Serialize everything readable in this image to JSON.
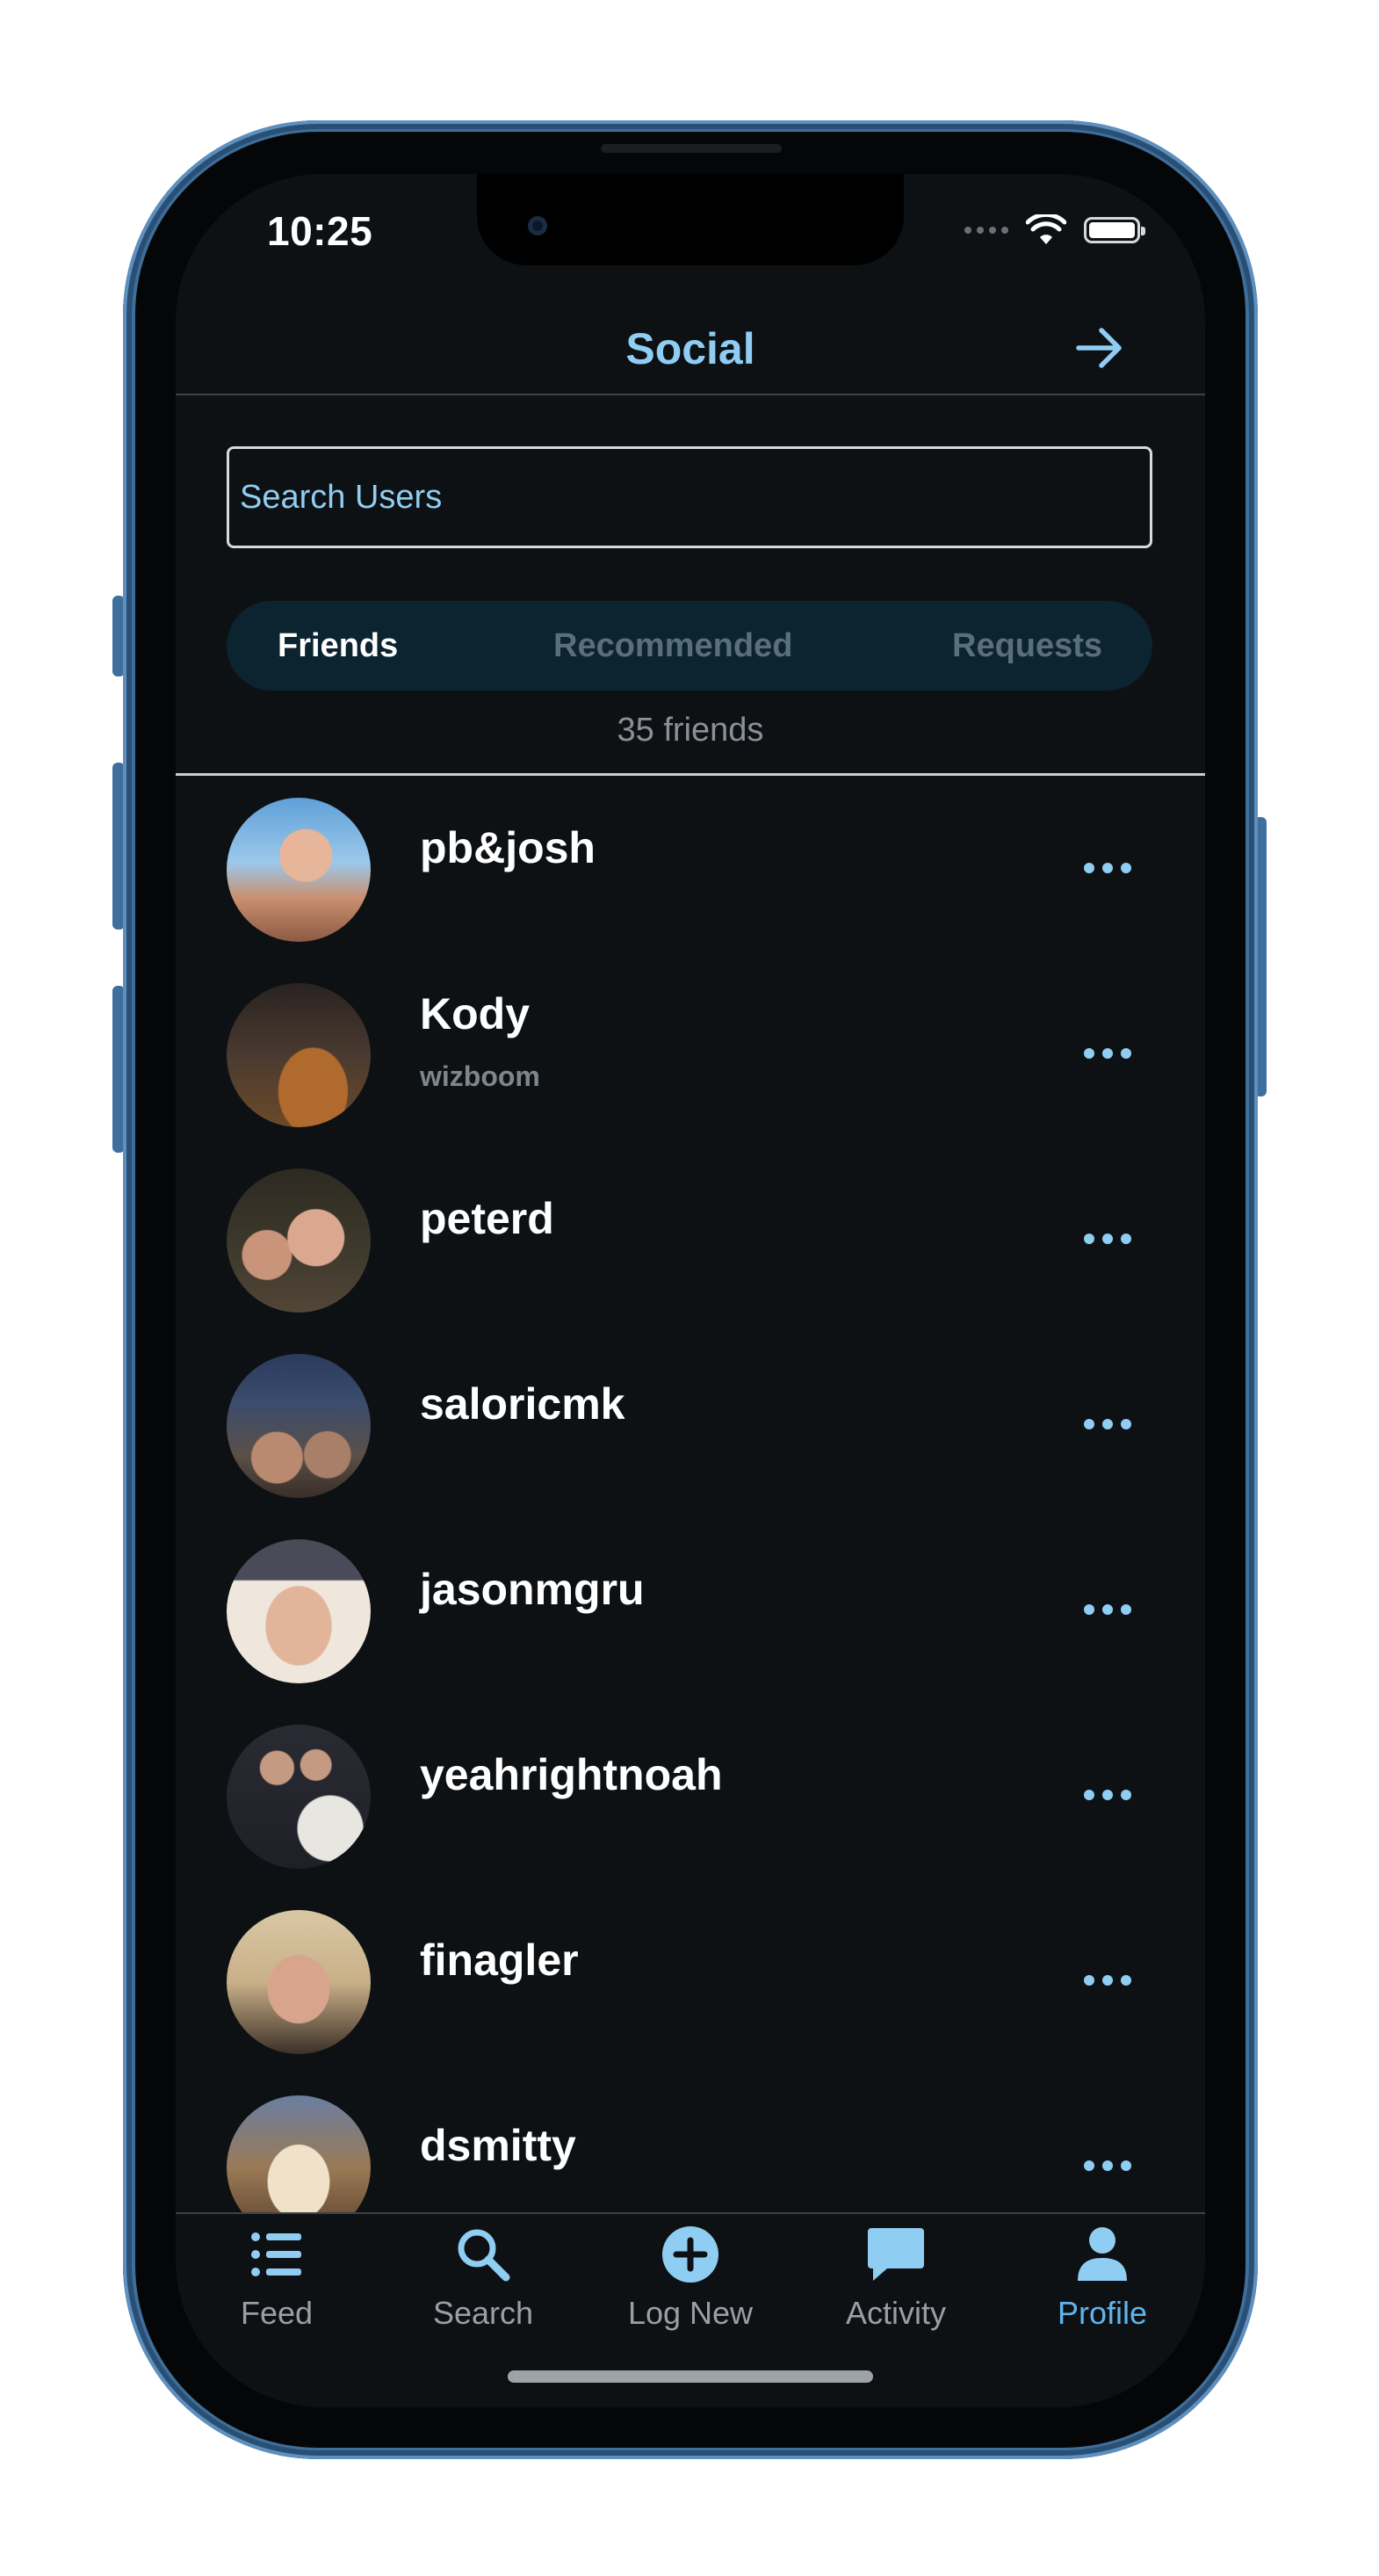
{
  "status": {
    "time": "10:25"
  },
  "header": {
    "title": "Social",
    "action_icon": "arrow-right-icon"
  },
  "search": {
    "placeholder": "Search Users",
    "value": ""
  },
  "tabs": [
    {
      "label": "Friends",
      "selected": true
    },
    {
      "label": "Recommended",
      "selected": false
    },
    {
      "label": "Requests",
      "selected": false
    }
  ],
  "friends_count": "35 friends",
  "friends": [
    {
      "name": "pb&josh",
      "subtitle": ""
    },
    {
      "name": "Kody",
      "subtitle": "wizboom"
    },
    {
      "name": "peterd",
      "subtitle": ""
    },
    {
      "name": "saloricmk",
      "subtitle": ""
    },
    {
      "name": "jasonmgru",
      "subtitle": ""
    },
    {
      "name": "yeahrightnoah",
      "subtitle": ""
    },
    {
      "name": "finagler",
      "subtitle": ""
    },
    {
      "name": "dsmitty",
      "subtitle": ""
    }
  ],
  "tabbar": [
    {
      "label": "Feed",
      "icon": "list-icon",
      "active": false
    },
    {
      "label": "Search",
      "icon": "search-icon",
      "active": false
    },
    {
      "label": "Log New",
      "icon": "plus-circle-icon",
      "active": false
    },
    {
      "label": "Activity",
      "icon": "chat-bubble-icon",
      "active": false
    },
    {
      "label": "Profile",
      "icon": "person-icon",
      "active": true
    }
  ],
  "colors": {
    "accent": "#8fcdf2",
    "active_tab": "#5fb4ef",
    "background": "#0e1114",
    "tab_bg": "#0b2430",
    "frame": "#3e6e9a"
  }
}
